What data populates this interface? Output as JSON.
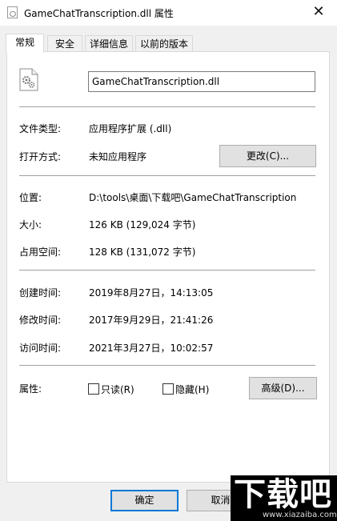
{
  "window": {
    "title": "GameChatTranscription.dll 属性",
    "close_glyph": "✕"
  },
  "tabs": [
    {
      "label": "常规",
      "active": true
    },
    {
      "label": "安全",
      "active": false
    },
    {
      "label": "详细信息",
      "active": false
    },
    {
      "label": "以前的版本",
      "active": false
    }
  ],
  "general": {
    "filename": "GameChatTranscription.dll",
    "file_type_label": "文件类型:",
    "file_type_value": "应用程序扩展 (.dll)",
    "open_with_label": "打开方式:",
    "open_with_value": "未知应用程序",
    "change_button": "更改(C)...",
    "location_label": "位置:",
    "location_value": "D:\\tools\\桌面\\下载吧\\GameChatTranscription",
    "size_label": "大小:",
    "size_value": "126 KB (129,024 字节)",
    "disk_size_label": "占用空间:",
    "disk_size_value": "128 KB (131,072 字节)",
    "created_label": "创建时间:",
    "created_value": "2019年8月27日，14:13:05",
    "modified_label": "修改时间:",
    "modified_value": "2017年9月29日，21:41:26",
    "accessed_label": "访问时间:",
    "accessed_value": "2021年3月27日，10:02:57",
    "attributes_label": "属性:",
    "readonly_label": "只读(R)",
    "readonly_checked": false,
    "hidden_label": "隐藏(H)",
    "hidden_checked": false,
    "advanced_button": "高级(D)..."
  },
  "footer": {
    "ok_button": "确定",
    "cancel_button": "取消"
  },
  "watermark": {
    "brand": "下载吧",
    "url": "www.xiazaiba.com"
  },
  "colors": {
    "accent": "#0078d7",
    "window_bg": "#f0f0f0",
    "panel_bg": "#ffffff"
  }
}
